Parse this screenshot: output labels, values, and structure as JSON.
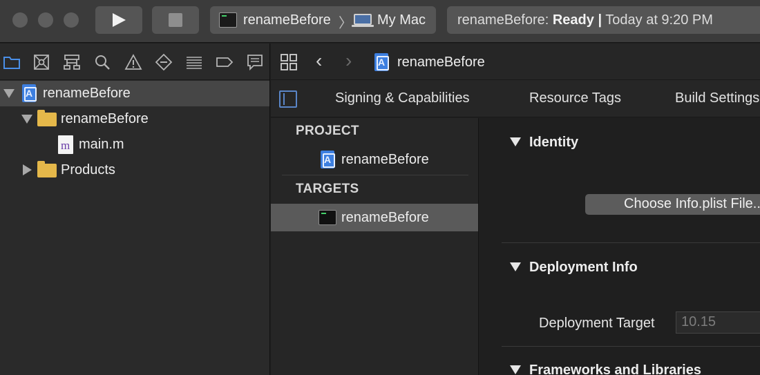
{
  "toolbar": {
    "scheme": {
      "name": "renameBefore",
      "destination": "My Mac"
    },
    "activity": {
      "project": "renameBefore:",
      "status": "Ready",
      "separator": "|",
      "time": "Today at 9:20 PM"
    }
  },
  "navigator": {
    "icons": [
      "folder-icon",
      "source-control-icon",
      "hierarchy-icon",
      "search-icon",
      "warning-icon",
      "test-diamond-icon",
      "debug-lines-icon",
      "breakpoint-icon",
      "report-icon"
    ],
    "tree": [
      {
        "label": "renameBefore",
        "kind": "project",
        "expanded": true
      },
      {
        "label": "renameBefore",
        "kind": "folder",
        "expanded": true
      },
      {
        "label": "main.m",
        "kind": "file"
      },
      {
        "label": "Products",
        "kind": "folder",
        "expanded": false
      }
    ]
  },
  "editor": {
    "jumpbar": {
      "title": "renameBefore"
    },
    "tabs": [
      "Signing & Capabilities",
      "Resource Tags",
      "Build Settings"
    ],
    "target_list": {
      "project_header": "PROJECT",
      "project_item": "renameBefore",
      "targets_header": "TARGETS",
      "target_item": "renameBefore"
    },
    "sections": {
      "identity": "Identity",
      "choose_plist": "Choose Info.plist File...",
      "deployment": "Deployment Info",
      "deployment_target_label": "Deployment Target",
      "deployment_target_value": "10.15",
      "frameworks": "Frameworks and Libraries"
    }
  },
  "colors": {
    "accent": "#3d7fe0",
    "selection": "#5a5a5a",
    "background": "#1f1f1f"
  }
}
